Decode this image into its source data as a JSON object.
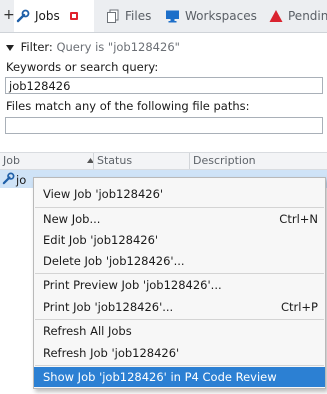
{
  "tabs": {
    "new_tab_glyph": "+",
    "jobs": "Jobs",
    "files": "Files",
    "workspaces": "Workspaces",
    "pending": "Pendin"
  },
  "filter": {
    "label": "Filter:",
    "query_text": "Query is \"job128426\"",
    "keywords_label": "Keywords or search query:",
    "keywords_value": "job128426",
    "paths_label": "Files match any of the following file paths:",
    "paths_value": ""
  },
  "table": {
    "columns": [
      "Job",
      "Status",
      "Description"
    ],
    "sorted_column": "Status",
    "row_prefix": "jo"
  },
  "menu": {
    "items": [
      {
        "label": "View Job 'job128426'",
        "shortcut": ""
      },
      {
        "label": "New Job...",
        "shortcut": "Ctrl+N"
      },
      {
        "label": "Edit Job 'job128426'",
        "shortcut": ""
      },
      {
        "label": "Delete Job 'job128426'...",
        "shortcut": ""
      },
      {
        "label": "Print Preview Job 'job128426'...",
        "shortcut": ""
      },
      {
        "label": "Print Job 'job128426'...",
        "shortcut": "Ctrl+P"
      },
      {
        "label": "Refresh All Jobs",
        "shortcut": ""
      },
      {
        "label": "Refresh Job 'job128426'",
        "shortcut": ""
      },
      {
        "label": "Show Job 'job128426' in P4 Code Review",
        "shortcut": ""
      }
    ],
    "highlighted_index": 8
  },
  "colors": {
    "accent": "#2c80d3",
    "selection": "#cfe3f7",
    "tab_close": "#e0232e"
  },
  "icons": [
    "wrench-icon",
    "files-icon",
    "monitor-icon",
    "warning-triangle-icon"
  ]
}
